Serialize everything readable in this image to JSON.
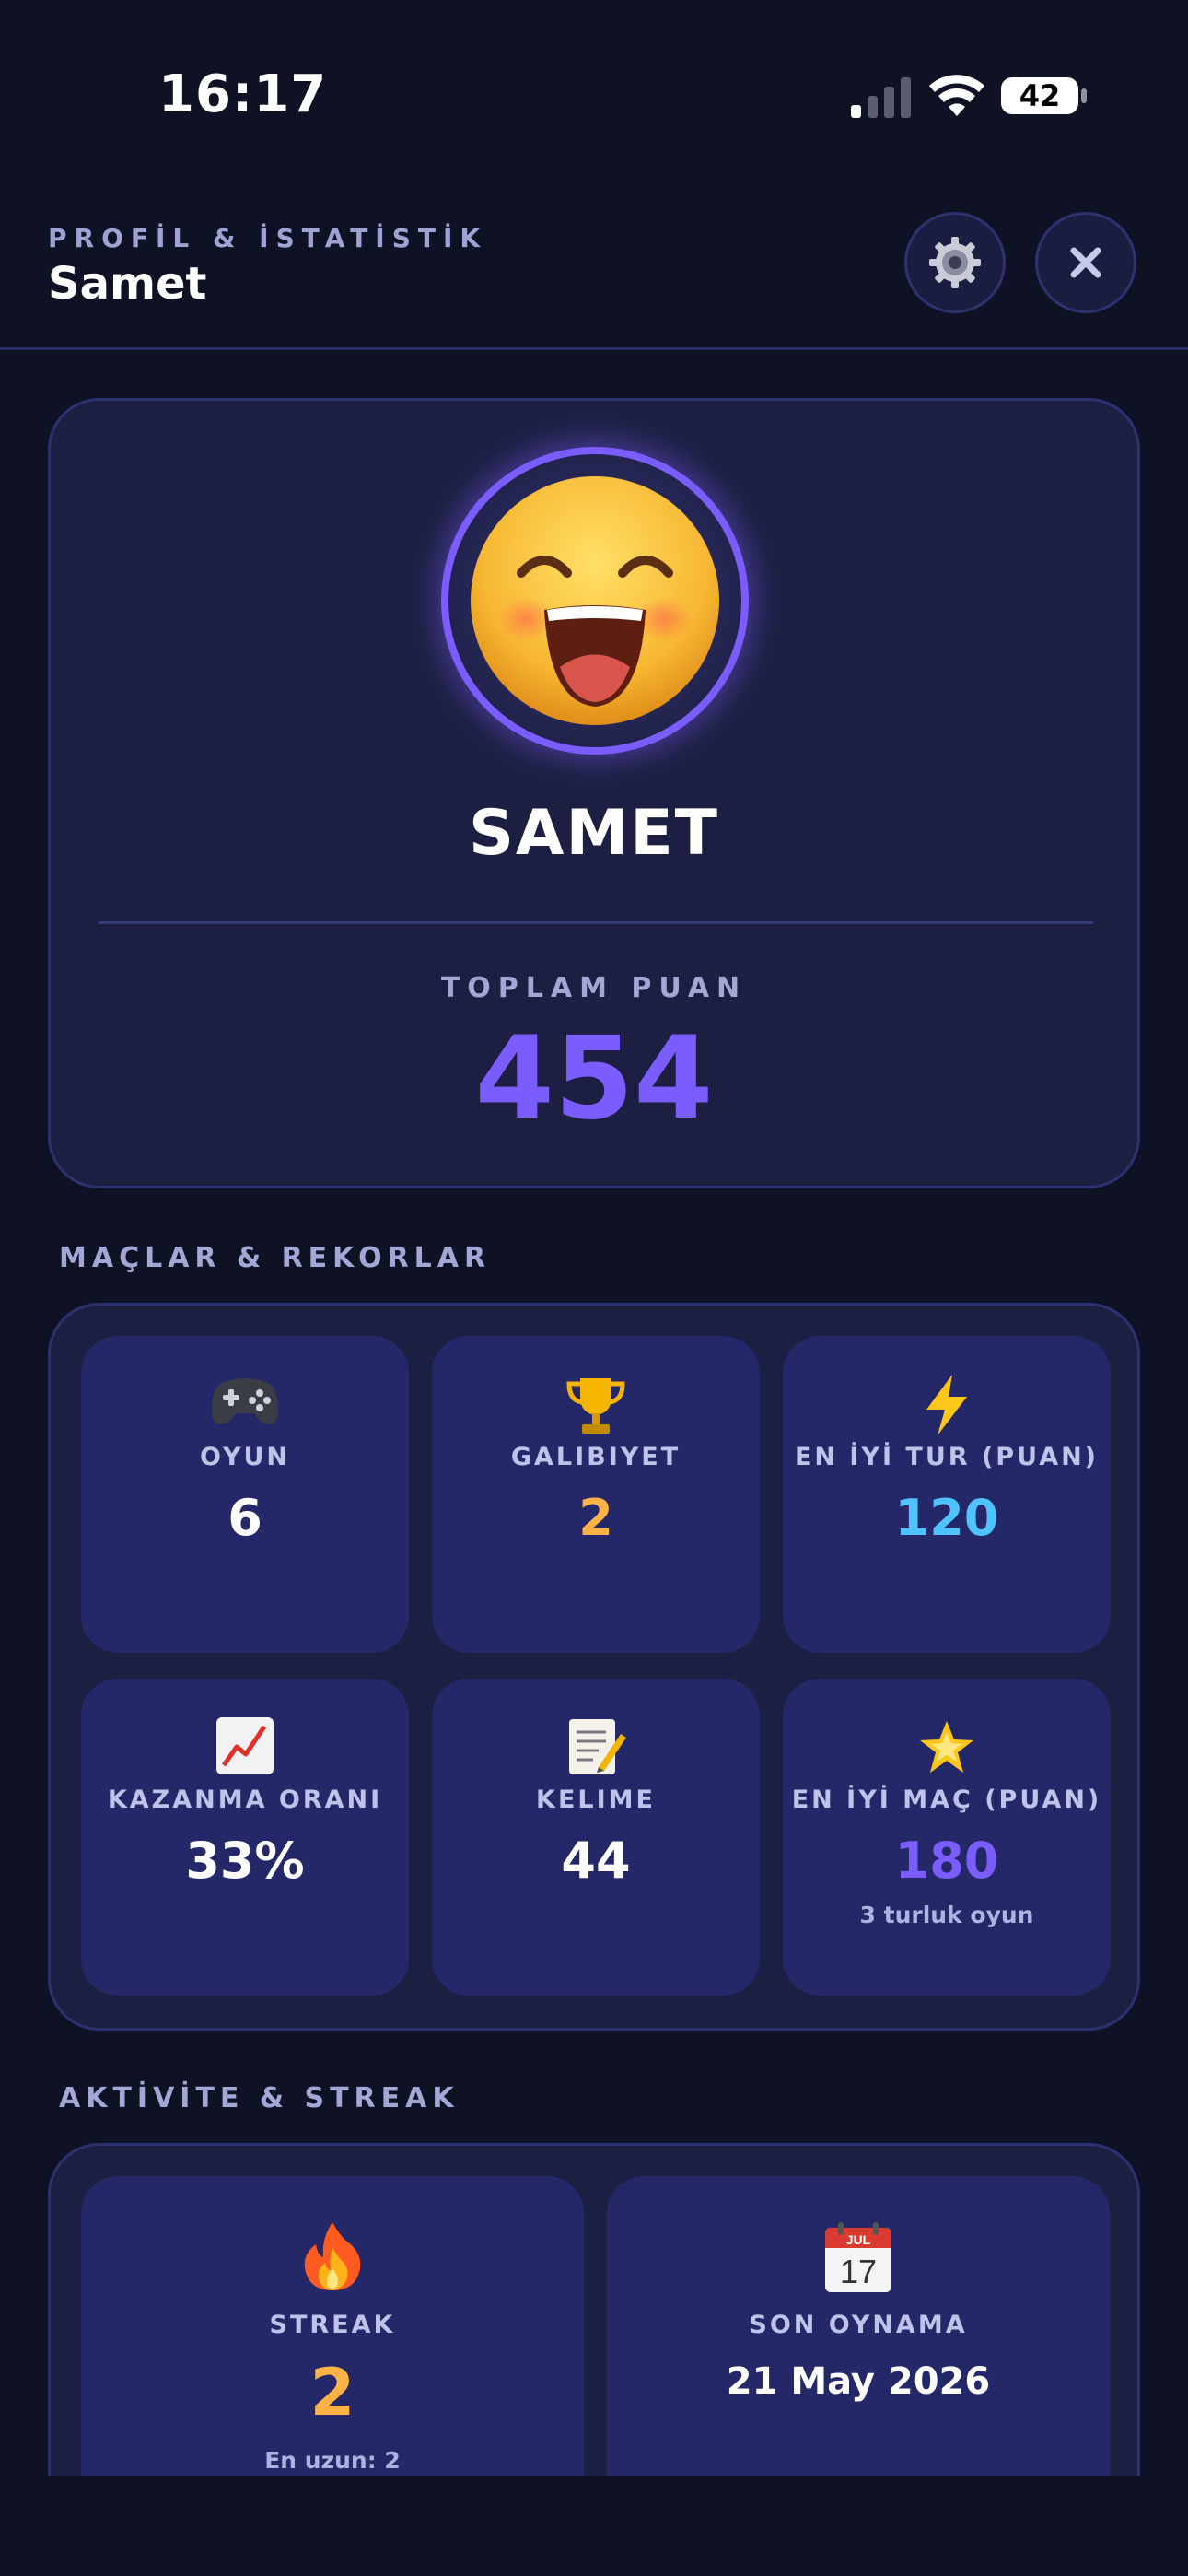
{
  "status": {
    "time": "16:17",
    "battery": "42"
  },
  "header": {
    "kicker": "PROFİL & İSTATİSTİK",
    "name": "Samet"
  },
  "profile": {
    "name": "SAMET",
    "total_label": "TOPLAM PUAN",
    "total_value": "454"
  },
  "sections": {
    "matches": "MAÇLAR & REKORLAR",
    "activity": "AKTİVİTE & STREAK"
  },
  "stats": [
    {
      "icon": "game-controller-icon",
      "label": "OYUN",
      "value": "6",
      "color": "#ffffff"
    },
    {
      "icon": "trophy-icon",
      "label": "GALIBIYET",
      "value": "2",
      "color": "#ffb347"
    },
    {
      "icon": "lightning-icon",
      "label": "EN İYİ TUR (PUAN)",
      "value": "120",
      "color": "#4fc3ff"
    },
    {
      "icon": "chart-increasing-icon",
      "label": "KAZANMA ORANI",
      "value": "33%",
      "color": "#ffffff"
    },
    {
      "icon": "memo-icon",
      "label": "KELIME",
      "value": "44",
      "color": "#ffffff"
    },
    {
      "icon": "glowing-star-icon",
      "label": "EN İYİ MAÇ (PUAN)",
      "value": "180",
      "sub": "3 turluk oyun",
      "color": "#7b5cff"
    }
  ],
  "activity": [
    {
      "icon": "fire-icon",
      "label": "STREAK",
      "value": "2",
      "sub": "En uzun: 2",
      "color": "#ffb347"
    },
    {
      "icon": "calendar-icon",
      "label": "SON OYNAMA",
      "value": "21 May 2026",
      "calendar_month": "JUL",
      "calendar_day": "17",
      "color": "#ffffff"
    }
  ],
  "colors": {
    "background": "#0f1224",
    "card": "#1c1f41",
    "tile": "#242868",
    "accent": "#7b5cff"
  }
}
